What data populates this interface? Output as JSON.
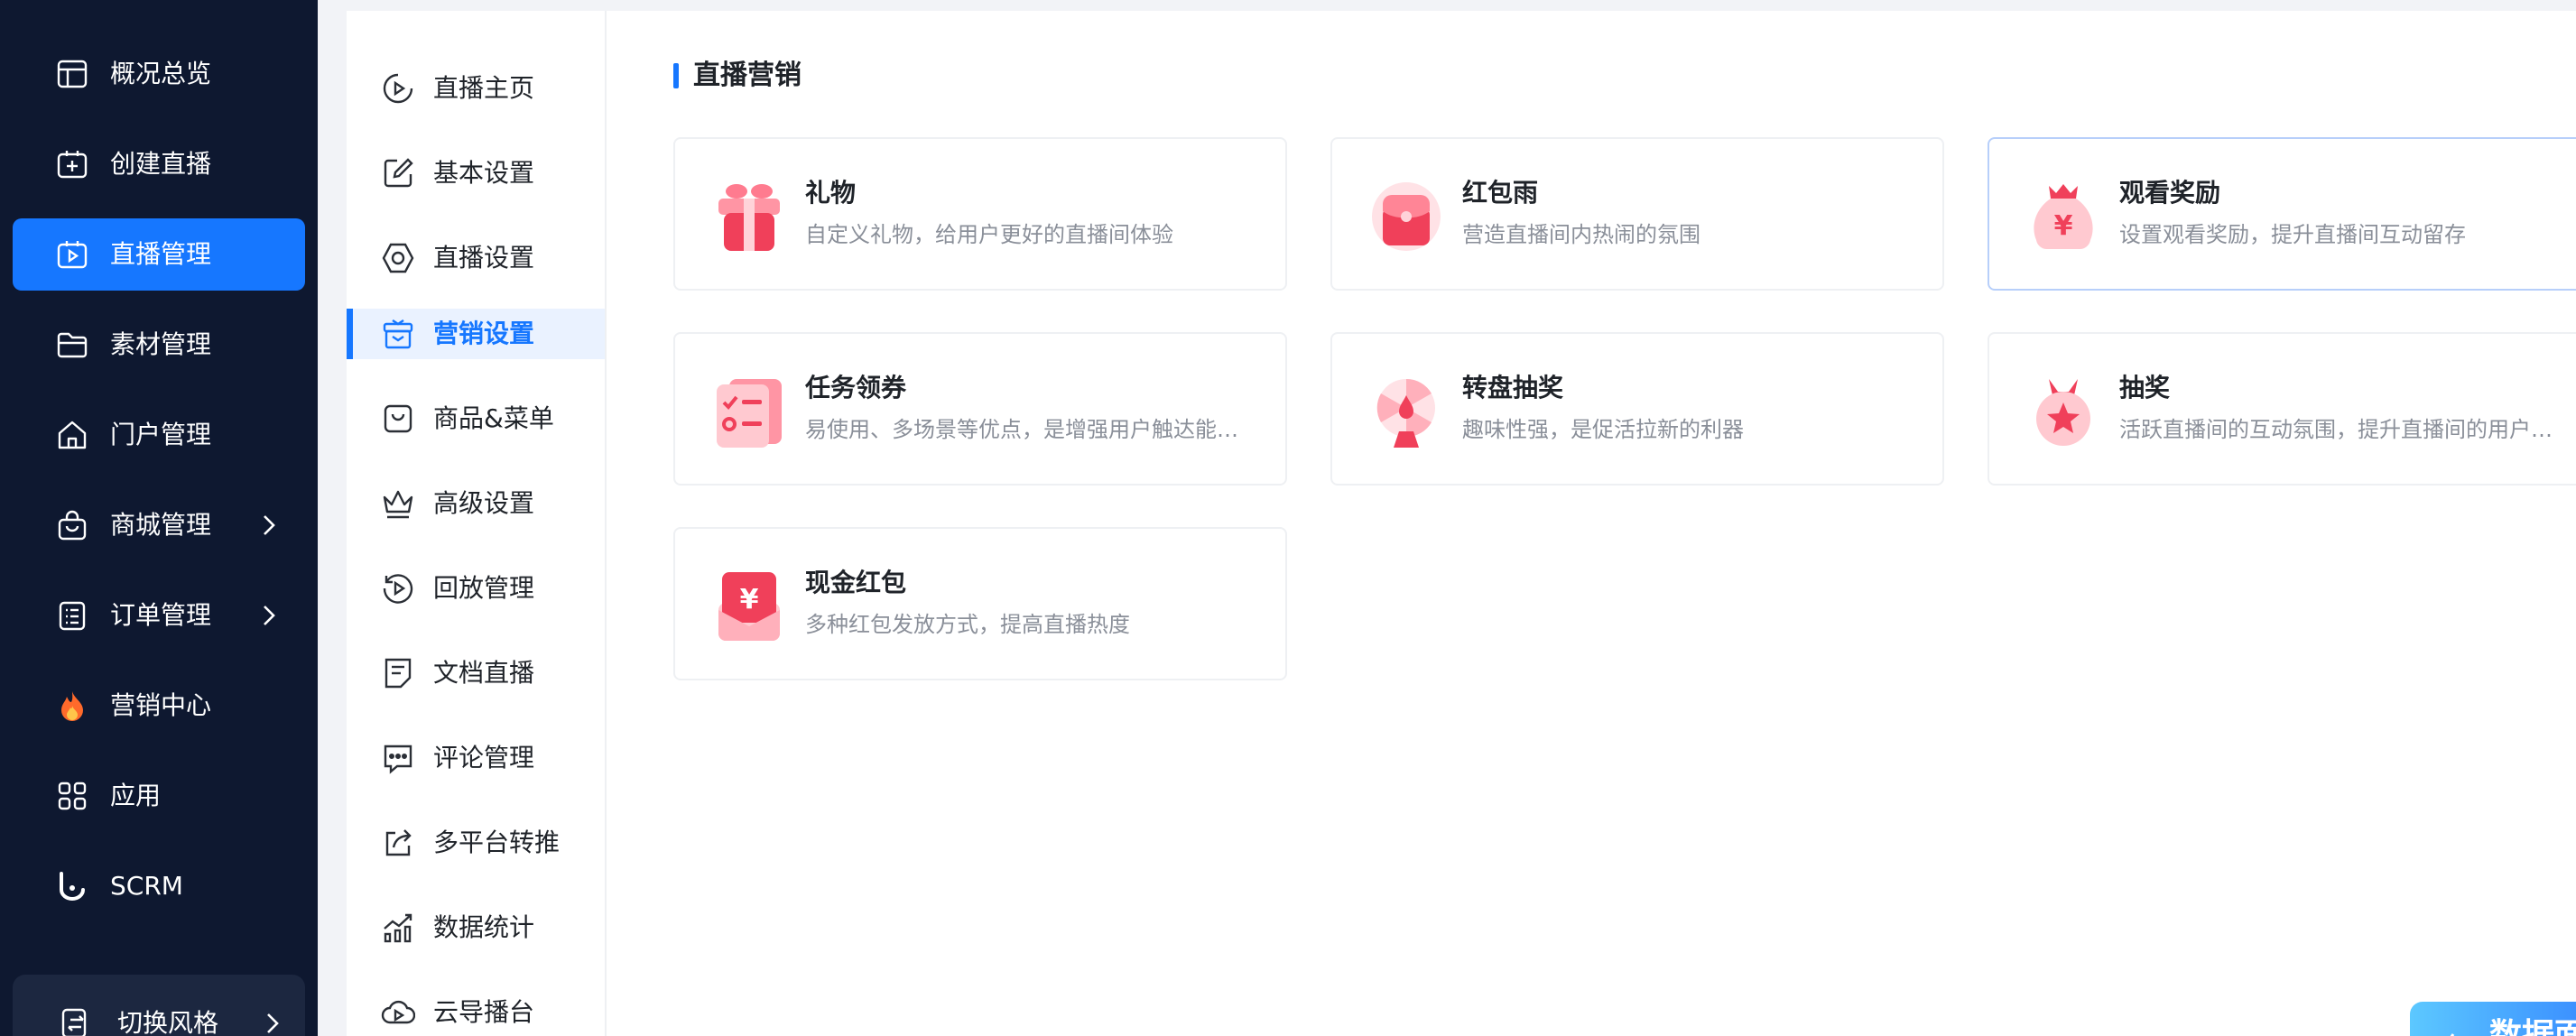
{
  "sidebar": {
    "items": [
      {
        "label": "概况总览",
        "icon": "dashboard-icon"
      },
      {
        "label": "创建直播",
        "icon": "create-live-icon"
      },
      {
        "label": "直播管理",
        "icon": "live-manage-icon",
        "active": true
      },
      {
        "label": "素材管理",
        "icon": "folder-icon"
      },
      {
        "label": "门户管理",
        "icon": "home-icon"
      },
      {
        "label": "商城管理",
        "icon": "shopping-bag-icon",
        "has_submenu": true
      },
      {
        "label": "订单管理",
        "icon": "order-list-icon",
        "has_submenu": true
      },
      {
        "label": "营销中心",
        "icon": "fire-icon"
      },
      {
        "label": "应用",
        "icon": "apps-grid-icon"
      },
      {
        "label": "SCRM",
        "icon": "scrm-logo-icon"
      }
    ],
    "style_switch_label": "切换风格"
  },
  "subnav": {
    "items": [
      {
        "label": "直播主页",
        "icon": "play-circle-icon"
      },
      {
        "label": "基本设置",
        "icon": "edit-icon"
      },
      {
        "label": "直播设置",
        "icon": "hexagon-settings-icon"
      },
      {
        "label": "营销设置",
        "icon": "gift-box-icon",
        "active": true
      },
      {
        "label": "商品&菜单",
        "icon": "bag-icon"
      },
      {
        "label": "高级设置",
        "icon": "crown-icon"
      },
      {
        "label": "回放管理",
        "icon": "replay-icon"
      },
      {
        "label": "文档直播",
        "icon": "document-icon"
      },
      {
        "label": "评论管理",
        "icon": "comment-icon"
      },
      {
        "label": "多平台转推",
        "icon": "share-icon"
      },
      {
        "label": "数据统计",
        "icon": "chart-icon"
      },
      {
        "label": "云导播台",
        "icon": "cloud-icon"
      }
    ]
  },
  "main": {
    "section_title": "直播营销",
    "cards": [
      {
        "title": "礼物",
        "desc": "自定义礼物，给用户更好的直播间体验",
        "icon": "gift-icon"
      },
      {
        "title": "红包雨",
        "desc": "营造直播间内热闹的氛围",
        "icon": "red-packet-rain-icon"
      },
      {
        "title": "观看奖励",
        "desc": "设置观看奖励，提升直播间互动留存",
        "icon": "money-bag-icon"
      },
      {
        "title": "任务领券",
        "desc": "易使用、多场景等优点，是增强用户触达能力的利器",
        "icon": "task-coupon-icon"
      },
      {
        "title": "转盘抽奖",
        "desc": "趣味性强，是促活拉新的利器",
        "icon": "lucky-wheel-icon"
      },
      {
        "title": "抽奖",
        "desc": "活跃直播间的互动氛围，提升直播间的用户参与度",
        "icon": "lottery-icon"
      },
      {
        "title": "现金红包",
        "desc": "多种红包发放方式，提高直播热度",
        "icon": "cash-red-packet-icon"
      }
    ]
  },
  "floating": {
    "data_button_label": "数据面板"
  },
  "colors": {
    "primary": "#1677ff",
    "sidebar_bg": "#0e1830",
    "icon_red": "#f0405a"
  }
}
